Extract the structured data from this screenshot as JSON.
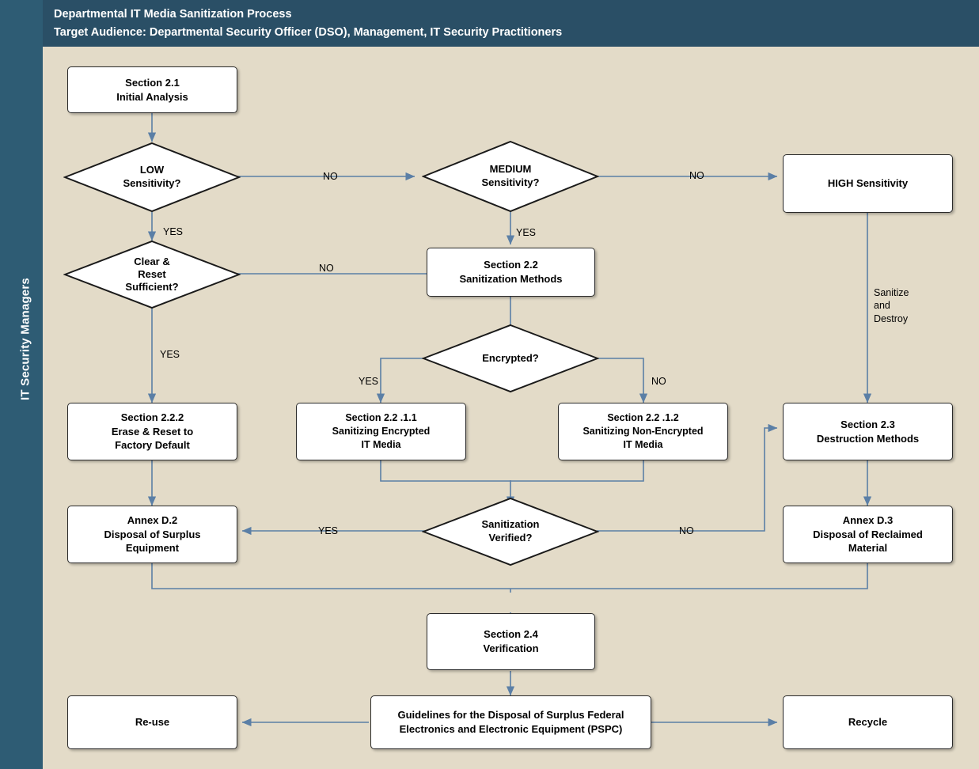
{
  "header": {
    "line1": "Departmental IT Media Sanitization Process",
    "line2": "Target Audience: Departmental Security Officer (DSO),  Management, IT Security Practitioners"
  },
  "sidebar": {
    "label": "IT Security Managers"
  },
  "nodes": {
    "initial_analysis": "Section 2.1\nInitial Analysis",
    "low_sensitivity": "LOW\nSensitivity?",
    "medium_sensitivity": "MEDIUM\nSensitivity?",
    "high_sensitivity": "HIGH Sensitivity",
    "clear_reset": "Clear &\nReset\nSufficient?",
    "sanitization_methods": "Section 2.2\nSanitization Methods",
    "encrypted": "Encrypted?",
    "erase_reset_factory": "Section 2.2.2\nErase & Reset to\nFactory Default",
    "sanitizing_encrypted": "Section 2.2 .1.1\nSanitizing Encrypted\nIT Media",
    "sanitizing_non_encrypted": "Section 2.2 .1.2\nSanitizing Non-Encrypted\nIT Media",
    "destruction_methods": "Section 2.3\nDestruction Methods",
    "disposal_surplus": "Annex D.2\nDisposal of Surplus\nEquipment",
    "sanitization_verified": "Sanitization\nVerified?",
    "disposal_reclaimed": "Annex D.3\nDisposal of Reclaimed\nMaterial",
    "verification": "Section 2.4\nVerification",
    "reuse": "Re-use",
    "guidelines": "Guidelines for the Disposal of Surplus Federal\nElectronics and Electronic Equipment (PSPC)",
    "recycle": "Recycle"
  },
  "edge_labels": {
    "low_no": "NO",
    "medium_no": "NO",
    "low_yes": "YES",
    "medium_yes": "YES",
    "clear_no": "NO",
    "clear_yes": "YES",
    "enc_yes": "YES",
    "enc_no": "NO",
    "high_sanitize_destroy": "Sanitize\nand\nDestroy",
    "verified_yes": "YES",
    "verified_no": "NO"
  },
  "colors": {
    "header_bg": "#2a4f66",
    "band_bg": "#2e5c74",
    "canvas_bg": "#e3dbc8",
    "node_bg": "#ffffff",
    "node_border": "#2b2b2b",
    "connector": "#5b7fa6"
  }
}
